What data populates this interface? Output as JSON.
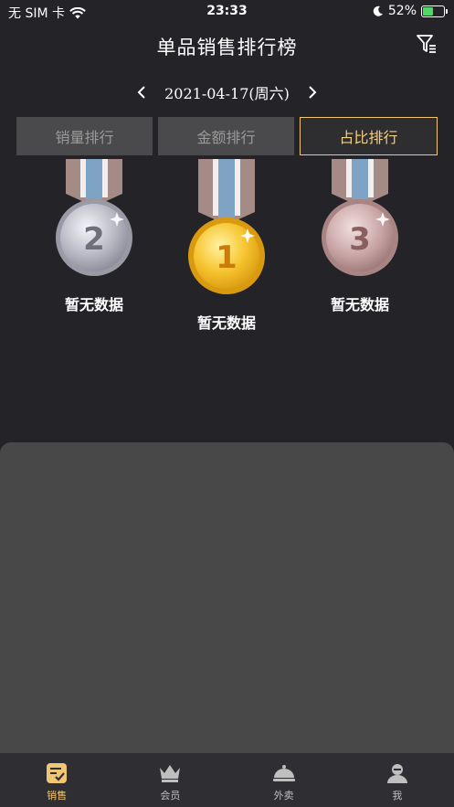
{
  "status_bar": {
    "carrier": "无 SIM 卡",
    "time": "23:33",
    "battery": "52%",
    "battery_level": 0.52
  },
  "header": {
    "title": "单品销售排行榜",
    "filter_icon": "filter-icon"
  },
  "date_nav": {
    "date": "2021-04-17(周六)",
    "prev_icon": "chevron-left-icon",
    "next_icon": "chevron-right-icon"
  },
  "tabs": [
    {
      "label": "销量排行",
      "active": false
    },
    {
      "label": "金额排行",
      "active": false
    },
    {
      "label": "占比排行",
      "active": true
    }
  ],
  "podium": {
    "first": {
      "rank": "1",
      "label": "暂无数据"
    },
    "second": {
      "rank": "2",
      "label": "暂无数据"
    },
    "third": {
      "rank": "3",
      "label": "暂无数据"
    }
  },
  "tabbar": [
    {
      "label": "销售",
      "icon": "sales-icon",
      "active": true
    },
    {
      "label": "会员",
      "icon": "crown-icon",
      "active": false
    },
    {
      "label": "外卖",
      "icon": "cloche-icon",
      "active": false
    },
    {
      "label": "我",
      "icon": "user-icon",
      "active": false
    }
  ],
  "colors": {
    "accent": "#f0c674",
    "background": "#242428",
    "panel": "#484848",
    "tab_inactive": "#4a4a4c"
  }
}
